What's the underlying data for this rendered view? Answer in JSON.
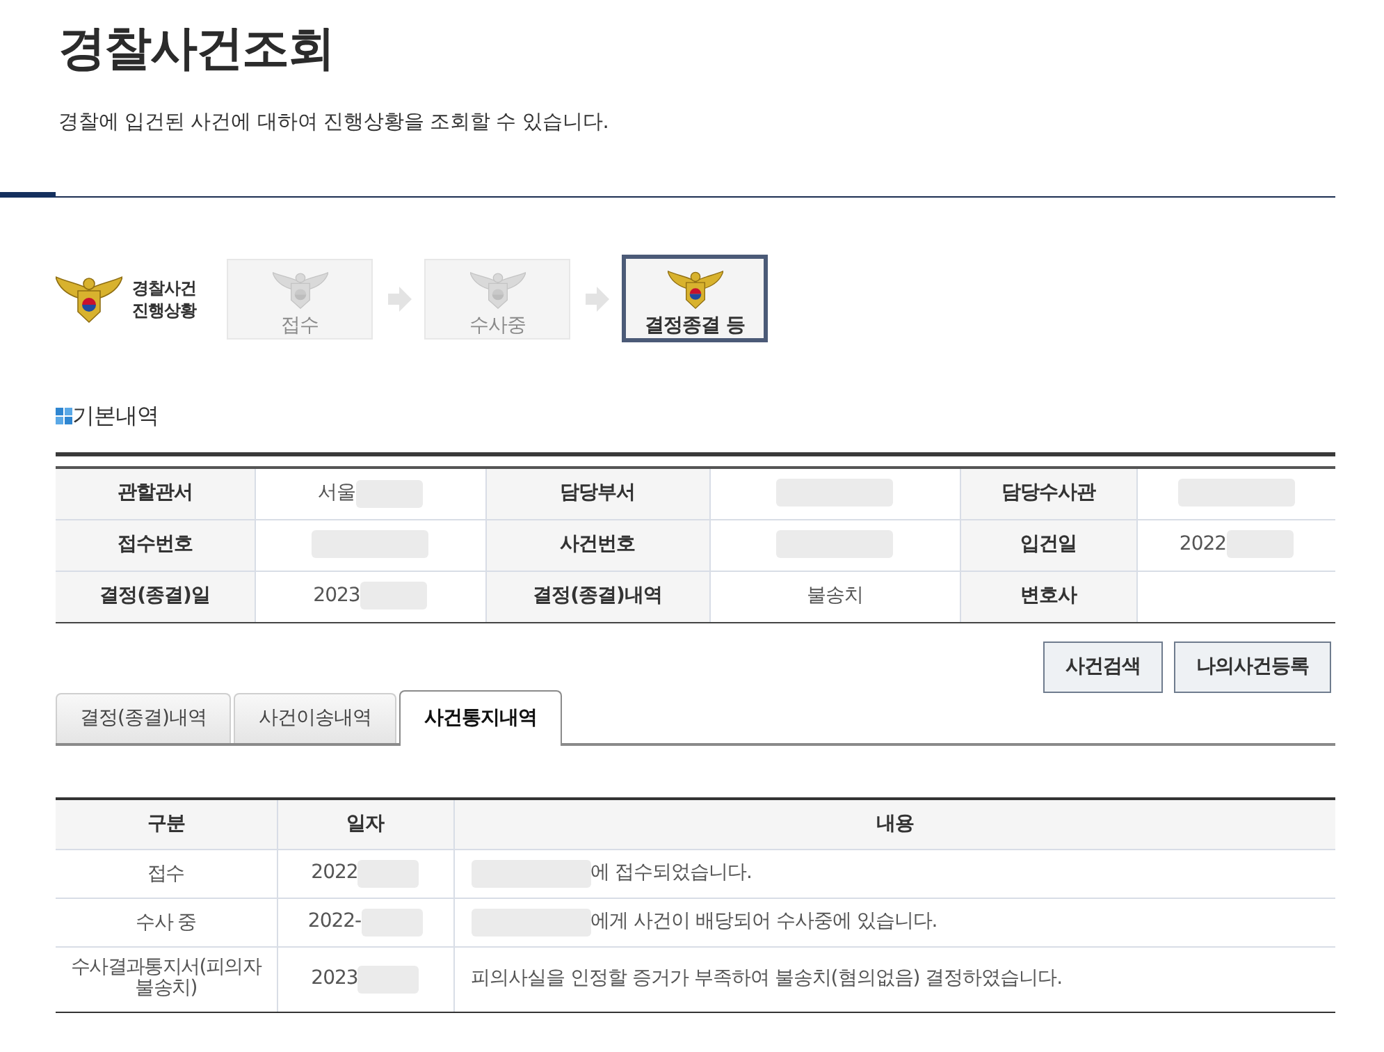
{
  "page": {
    "title": "경찰사건조회",
    "description": "경찰에 입건된 사건에 대하여 진행상황을 조회할 수 있습니다."
  },
  "progress": {
    "label": "경찰사건 진행상황",
    "steps": [
      {
        "label": "접수",
        "selected": false
      },
      {
        "label": "수사중",
        "selected": false
      },
      {
        "label": "결정종결 등",
        "selected": true
      }
    ]
  },
  "basic_info": {
    "heading": "기본내역",
    "rows": [
      [
        {
          "label": "관할관서",
          "value": "서울",
          "redacted": true
        },
        {
          "label": "담당부서",
          "redacted": true
        },
        {
          "label": "담당수사관",
          "redacted": true
        }
      ],
      [
        {
          "label": "접수번호",
          "redacted": true
        },
        {
          "label": "사건번호",
          "redacted": true
        },
        {
          "label": "입건일",
          "value": "2022",
          "redacted": true
        }
      ],
      [
        {
          "label": "결정(종결)일",
          "value": "2023",
          "redacted": true
        },
        {
          "label": "결정(종결)내역",
          "value": "불송치",
          "redacted": false
        },
        {
          "label": "변호사",
          "redacted": false
        }
      ]
    ]
  },
  "buttons": [
    "사건검색",
    "나의사건등록"
  ],
  "tabs": [
    {
      "label": "결정(종결)내역",
      "selected": false
    },
    {
      "label": "사건이송내역",
      "selected": false
    },
    {
      "label": "사건통지내역",
      "selected": true
    }
  ],
  "notice_table": {
    "columns": [
      "구분",
      "일자",
      "내용"
    ],
    "rows": [
      {
        "category": "접수",
        "date": {
          "text": "2022",
          "redacted": true
        },
        "content": {
          "text": "에 접수되었습니다.",
          "redacted": true
        }
      },
      {
        "category": "수사 중",
        "date": {
          "text": "2022-",
          "redacted": true
        },
        "content": {
          "text": "에게 사건이 배당되어 수사중에 있습니다.",
          "redacted": true
        }
      },
      {
        "category": "수사결과통지서(피의자 불송치)",
        "date": {
          "text": "2023",
          "redacted": true
        },
        "content": {
          "text": "피의사실을 인정할 증거가 부족하여 불송치(혐의없음) 결정하였습니다.",
          "redacted": false
        }
      }
    ]
  }
}
